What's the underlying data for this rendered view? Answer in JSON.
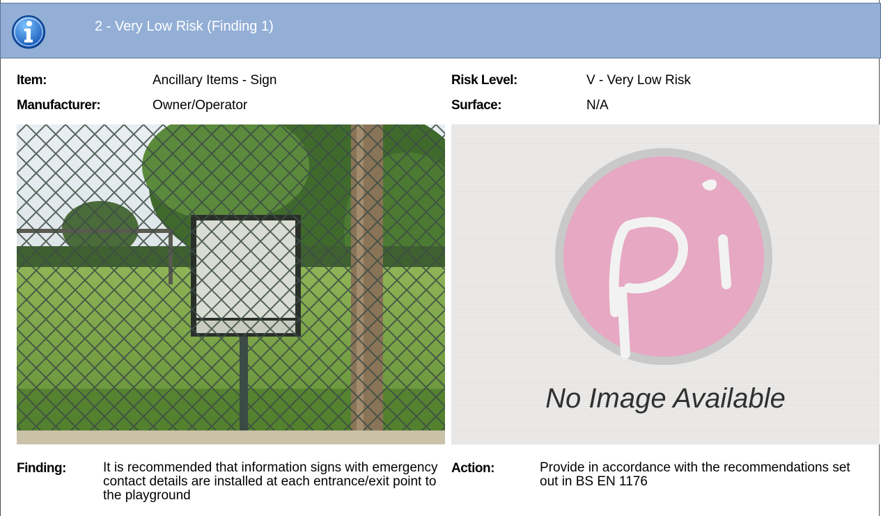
{
  "header": {
    "title": "2 - Very Low Risk (Finding 1)",
    "icon": "info-icon",
    "background_color": "#93afd6"
  },
  "details": {
    "item_label": "Item:",
    "item_value": "Ancillary Items - Sign",
    "manufacturer_label": "Manufacturer:",
    "manufacturer_value": "Owner/Operator",
    "risk_label": "Risk Level:",
    "risk_value": "V - Very Low Risk",
    "surface_label": "Surface:",
    "surface_value": "N/A"
  },
  "images": {
    "photo_description": "sign-behind-chain-link-fence",
    "placeholder_text": "No Image Available"
  },
  "finding": {
    "label": "Finding:",
    "text": "It is recommended that information signs with emergency contact details are installed at each entrance/exit point to the playground"
  },
  "action": {
    "label": "Action:",
    "text": "Provide in accordance with the recommendations set out in BS EN 1176"
  }
}
